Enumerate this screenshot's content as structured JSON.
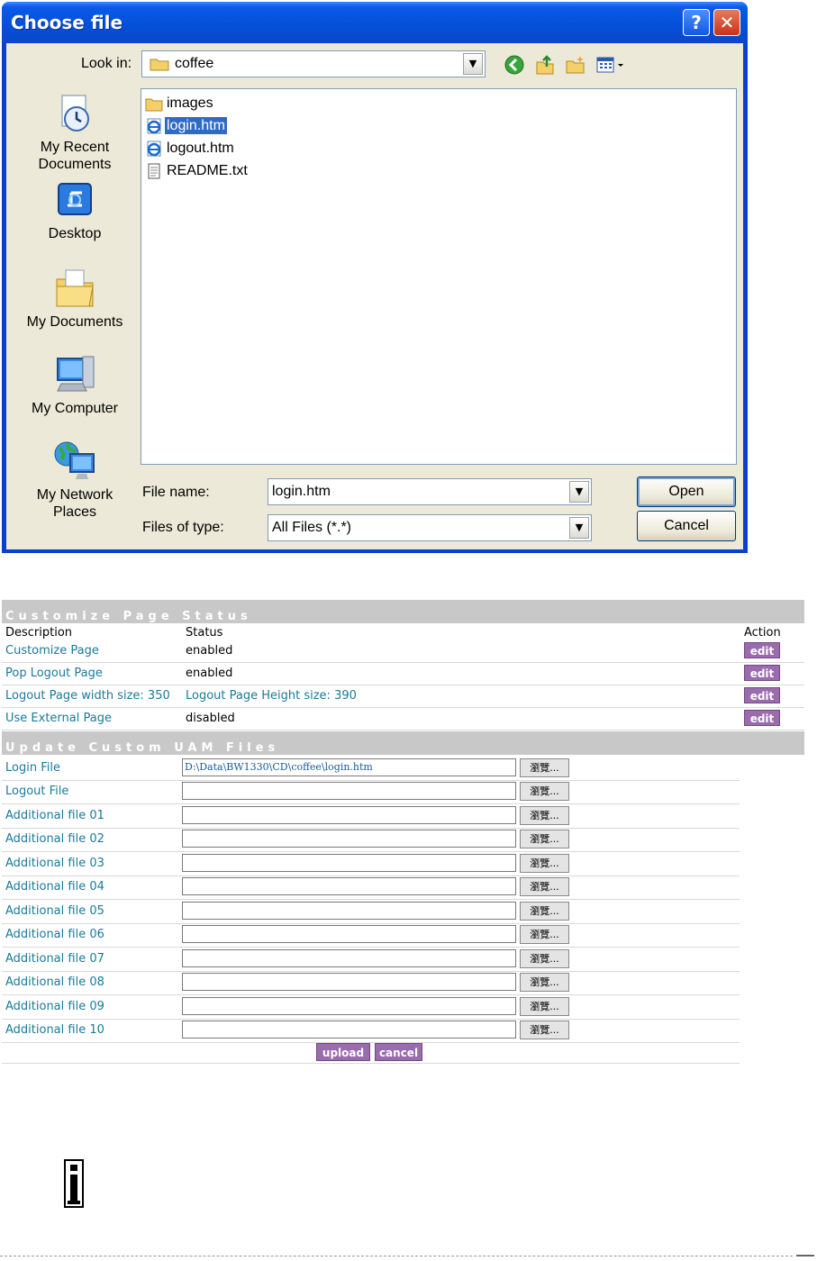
{
  "dialog": {
    "title": "Choose file",
    "look_in_label": "Look in:",
    "look_in_value": "coffee",
    "places": [
      {
        "label": "My Recent\nDocuments",
        "icon": "recent-documents-icon"
      },
      {
        "label": "Desktop",
        "icon": "desktop-icon"
      },
      {
        "label": "My Documents",
        "icon": "my-documents-icon"
      },
      {
        "label": "My Computer",
        "icon": "my-computer-icon"
      },
      {
        "label": "My Network\nPlaces",
        "icon": "network-places-icon"
      }
    ],
    "files": [
      {
        "name": "images",
        "icon": "folder-icon",
        "selected": false
      },
      {
        "name": "login.htm",
        "icon": "html-file-icon",
        "selected": true
      },
      {
        "name": "logout.htm",
        "icon": "html-file-icon",
        "selected": false
      },
      {
        "name": "README.txt",
        "icon": "text-file-icon",
        "selected": false
      }
    ],
    "file_name_label": "File name:",
    "file_name_value": "login.htm",
    "file_type_label": "Files of type:",
    "file_type_value": "All Files (*.*)",
    "open_button": "Open",
    "cancel_button": "Cancel",
    "help_glyph": "?",
    "close_glyph": "✕"
  },
  "status": {
    "section_title": "Customize Page Status",
    "col_description": "Description",
    "col_status": "Status",
    "col_action": "Action",
    "rows": [
      {
        "description": "Customize Page",
        "status": "enabled",
        "action": "edit"
      },
      {
        "description": "Pop Logout Page",
        "status": "enabled",
        "action": "edit"
      },
      {
        "description": "Logout Page width size: 350",
        "status": "Logout Page Height size: 390",
        "action": "edit"
      },
      {
        "description": "Use External Page",
        "status": "disabled",
        "action": "edit"
      }
    ]
  },
  "uam": {
    "section_title": "Update Custom UAM Files",
    "browse_label": "瀏覽...",
    "rows": [
      {
        "label": "Login File",
        "value": "D:\\Data\\BW1330\\CD\\coffee\\login.htm"
      },
      {
        "label": "Logout File",
        "value": ""
      },
      {
        "label": "Additional file 01",
        "value": ""
      },
      {
        "label": "Additional file 02",
        "value": ""
      },
      {
        "label": "Additional file 03",
        "value": ""
      },
      {
        "label": "Additional file 04",
        "value": ""
      },
      {
        "label": "Additional file 05",
        "value": ""
      },
      {
        "label": "Additional file 06",
        "value": ""
      },
      {
        "label": "Additional file 07",
        "value": ""
      },
      {
        "label": "Additional file 08",
        "value": ""
      },
      {
        "label": "Additional file 09",
        "value": ""
      },
      {
        "label": "Additional file 10",
        "value": ""
      }
    ],
    "upload_button": "upload",
    "cancel_button": "cancel"
  },
  "note": {
    "icon": "info-icon"
  }
}
